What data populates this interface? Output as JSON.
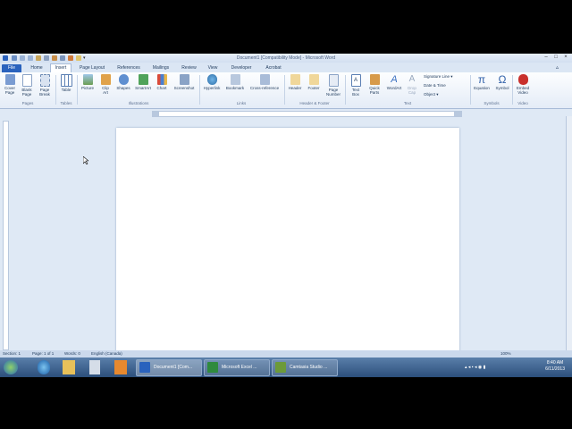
{
  "window": {
    "title": "Document1 [Compatibility Mode] - Microsoft Word"
  },
  "tabs": [
    {
      "label": "File"
    },
    {
      "label": "Home"
    },
    {
      "label": "Insert"
    },
    {
      "label": "Page Layout"
    },
    {
      "label": "References"
    },
    {
      "label": "Mailings"
    },
    {
      "label": "Review"
    },
    {
      "label": "View"
    },
    {
      "label": "Developer"
    },
    {
      "label": "Acrobat"
    }
  ],
  "ribbon": {
    "buttons": [
      {
        "label": "Cover\nPage",
        "icon": "cover-page-icon"
      },
      {
        "label": "Blank\nPage",
        "icon": "blank-page-icon"
      },
      {
        "label": "Page\nBreak",
        "icon": "page-break-icon"
      },
      {
        "label": "Table",
        "icon": "table-icon"
      },
      {
        "label": "Picture",
        "icon": "picture-icon"
      },
      {
        "label": "Clip\nArt",
        "icon": "clip-art-icon"
      },
      {
        "label": "Shapes",
        "icon": "shapes-icon"
      },
      {
        "label": "SmartArt",
        "icon": "smartart-icon"
      },
      {
        "label": "Chart",
        "icon": "chart-icon"
      },
      {
        "label": "Screenshot",
        "icon": "screenshot-icon"
      },
      {
        "label": "Hyperlink",
        "icon": "hyperlink-icon"
      },
      {
        "label": "Bookmark",
        "icon": "bookmark-icon"
      },
      {
        "label": "Cross-reference",
        "icon": "cross-reference-icon"
      },
      {
        "label": "Header",
        "icon": "header-icon"
      },
      {
        "label": "Footer",
        "icon": "footer-icon"
      },
      {
        "label": "Page\nNumber",
        "icon": "page-number-icon"
      },
      {
        "label": "Text\nBox",
        "icon": "text-box-icon"
      },
      {
        "label": "Quick\nParts",
        "icon": "quick-parts-icon"
      },
      {
        "label": "WordArt",
        "icon": "wordart-icon"
      },
      {
        "label": "Drop\nCap",
        "icon": "drop-cap-icon"
      },
      {
        "label": "Equation",
        "icon": "equation-icon"
      },
      {
        "label": "Symbol",
        "icon": "symbol-icon"
      },
      {
        "label": "Embed\nVideo",
        "icon": "embed-video-icon"
      }
    ],
    "small_items": [
      "Signature Line",
      "Date & Time",
      "Object"
    ],
    "groups": [
      "Pages",
      "Tables",
      "Illustrations",
      "Links",
      "Header & Footer",
      "Text",
      "Symbols",
      "Video"
    ]
  },
  "status": {
    "section": "Section: 1",
    "page": "Page: 1 of 1",
    "words": "Words: 0",
    "language": "English (Canada)",
    "zoom": "100%"
  },
  "taskbar": {
    "items": [
      {
        "label": "Document1 [Com...",
        "icon": "word-icon"
      },
      {
        "label": "Microsoft Excel ...",
        "icon": "excel-icon"
      },
      {
        "label": "Camtasia Studio ...",
        "icon": "camtasia-icon"
      }
    ],
    "clock_time": "8:40 AM",
    "clock_date": "6/11/2013"
  },
  "colors": {
    "file_tab": "#2a62bd",
    "accent": "#1e395b"
  }
}
